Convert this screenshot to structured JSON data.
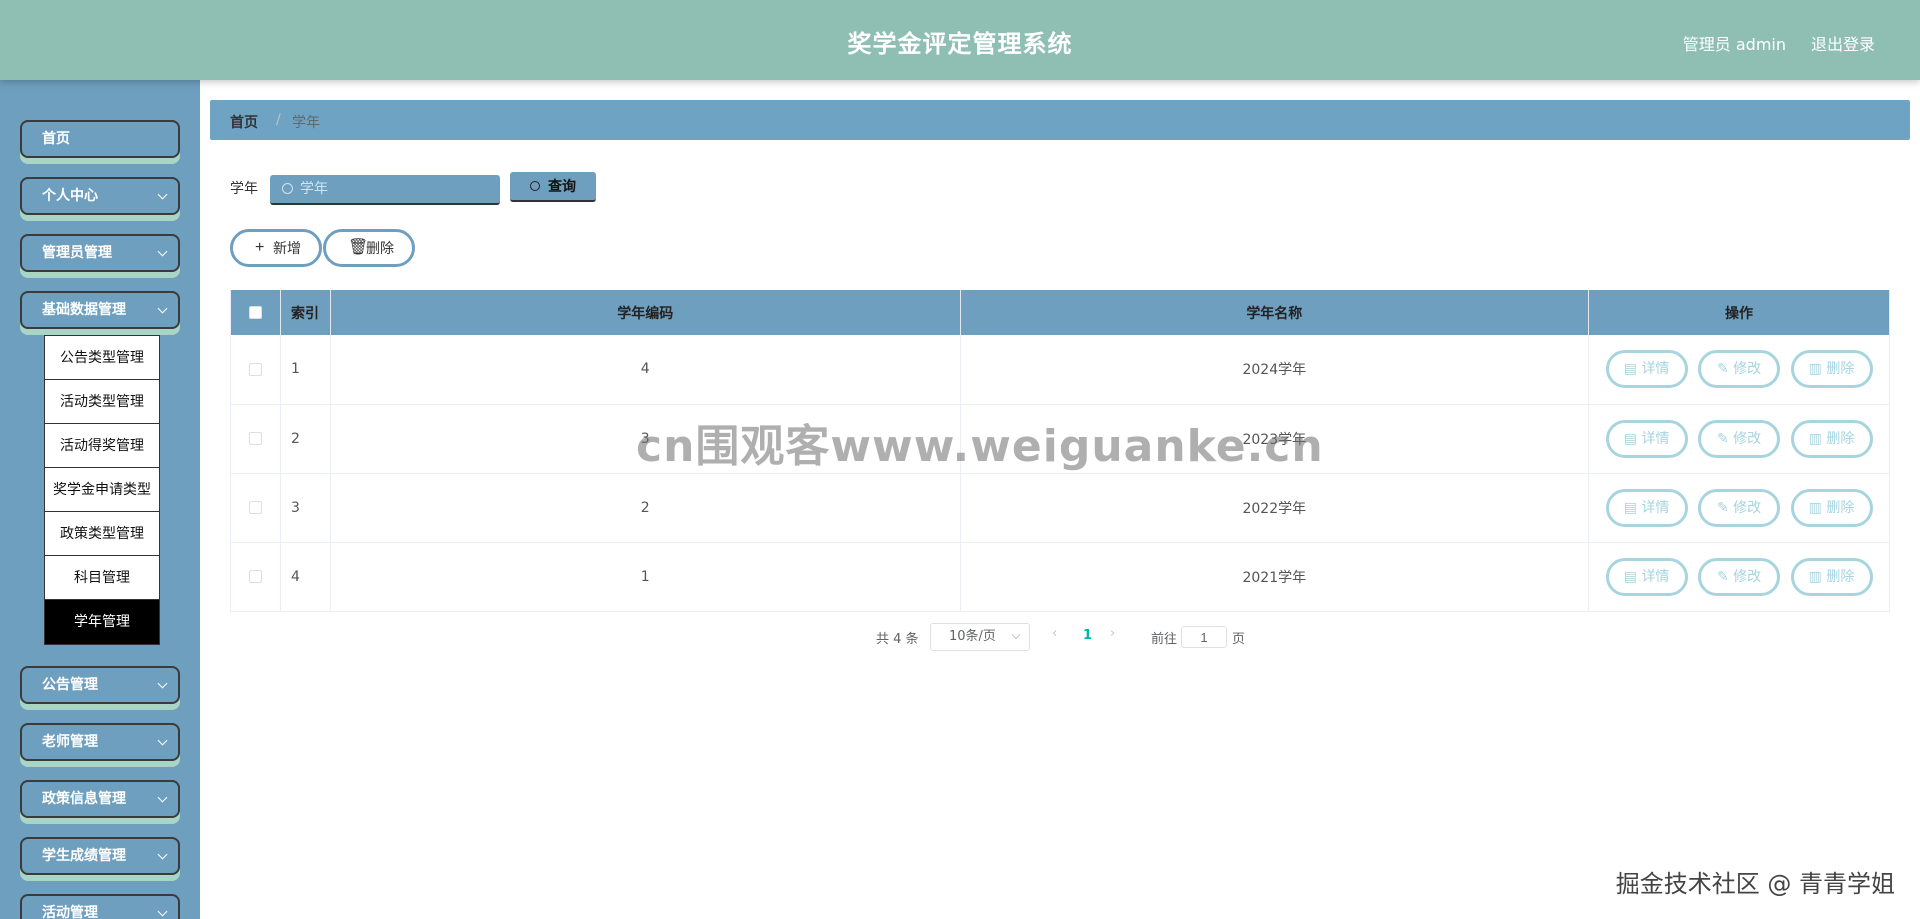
{
  "header": {
    "title": "奖学金评定管理系统",
    "user": "管理员 admin",
    "logout": "退出登录"
  },
  "sidebar": {
    "menu": [
      {
        "label": "首页",
        "has_arrow": false
      },
      {
        "label": "个人中心",
        "has_arrow": true
      },
      {
        "label": "管理员管理",
        "has_arrow": true
      },
      {
        "label": "基础数据管理",
        "has_arrow": true
      },
      {
        "label": "公告管理",
        "has_arrow": true
      },
      {
        "label": "老师管理",
        "has_arrow": true
      },
      {
        "label": "政策信息管理",
        "has_arrow": true
      },
      {
        "label": "学生成绩管理",
        "has_arrow": true
      },
      {
        "label": "活动管理",
        "has_arrow": true
      }
    ],
    "submenu": [
      {
        "label": "公告类型管理",
        "active": false
      },
      {
        "label": "活动类型管理",
        "active": false
      },
      {
        "label": "活动得奖管理",
        "active": false
      },
      {
        "label": "奖学金申请类型",
        "active": false
      },
      {
        "label": "政策类型管理",
        "active": false
      },
      {
        "label": "科目管理",
        "active": false
      },
      {
        "label": "学年管理",
        "active": true
      }
    ]
  },
  "breadcrumb": {
    "home": "首页",
    "separator": "/",
    "current": "学年"
  },
  "search": {
    "label": "学年",
    "placeholder": "学年",
    "value": "",
    "query_label": "查询"
  },
  "actions": {
    "add_label": "新增",
    "delete_label": "删除"
  },
  "table": {
    "columns": [
      "",
      "索引",
      "学年编码",
      "学年名称",
      "操作"
    ],
    "rows": [
      {
        "index": "1",
        "code": "4",
        "name": "2024学年"
      },
      {
        "index": "2",
        "code": "3",
        "name": "2023学年"
      },
      {
        "index": "3",
        "code": "2",
        "name": "2022学年"
      },
      {
        "index": "4",
        "code": "1",
        "name": "2021学年"
      }
    ],
    "row_actions": {
      "detail": "详情",
      "edit": "修改",
      "delete": "删除"
    }
  },
  "pagination": {
    "total": "共 4 条",
    "page_size": "10条/页",
    "current_page": "1",
    "goto_label": "前往",
    "goto_value": "1",
    "page_suffix": "页"
  },
  "overlays": {
    "watermark": "cn围观客www.weiguanke.cn",
    "corner_text": "掘金技术社区 @ 青青学姐"
  },
  "colors": {
    "header": "#8fbfb3",
    "sidebar": "#6f9fbf",
    "accent_shadow": "#a8d5c5",
    "table_header": "#6f9fbf",
    "row_action_border": "#a7d4df",
    "active_page": "#00b8a9"
  }
}
